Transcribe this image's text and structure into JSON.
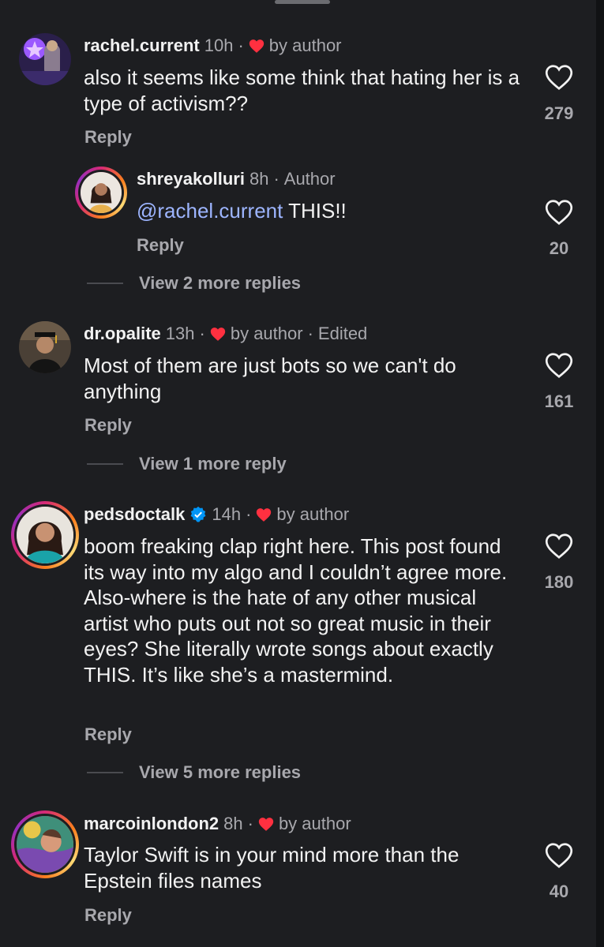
{
  "comments": [
    {
      "username": "rachel.current",
      "time": "10h",
      "sep": "·",
      "badge": "by author",
      "text": "also it seems like some think that hating her is a type of activism??",
      "reply_label": "Reply",
      "likes": "279"
    },
    {
      "username": "shreyakolluri",
      "time": "8h",
      "sep": "·",
      "badge": "Author",
      "mention": "@rachel.current",
      "text": " THIS!!",
      "reply_label": "Reply",
      "likes": "20",
      "view_more": "View 2 more replies"
    },
    {
      "username": "dr.opalite",
      "time": "13h",
      "sep": "·",
      "badge": "by author",
      "sep2": "·",
      "edited": "Edited",
      "text": "Most of them are just bots so we can't do anything",
      "reply_label": "Reply",
      "likes": "161",
      "view_more": "View 1 more reply"
    },
    {
      "username": "pedsdoctalk",
      "time": "14h",
      "sep": "·",
      "badge": "by author",
      "text": "boom freaking clap right here. This post found its way into my algo and I couldn’t agree more. Also-where is the hate of any other musical artist who puts out not so great music in their eyes? She literally wrote songs about exactly THIS. It’s like she’s a mastermind.",
      "reply_label": "Reply",
      "likes": "180",
      "view_more": "View 5 more replies"
    },
    {
      "username": "marcoinlondon2",
      "time": "8h",
      "sep": "·",
      "badge": "by author",
      "text": "Taylor Swift is in your mind more than the Epstein files names",
      "reply_label": "Reply",
      "likes": "40"
    }
  ],
  "colors": {
    "background": "#1d1e21",
    "heart_red": "#ff3040",
    "mention_blue": "#9db5ff",
    "verified_blue": "#0095f6",
    "secondary_text": "#a8a8ad"
  },
  "icons": {
    "like": "heart-outline-icon",
    "author_liked": "heart-filled-icon",
    "verified": "verified-badge-icon"
  }
}
